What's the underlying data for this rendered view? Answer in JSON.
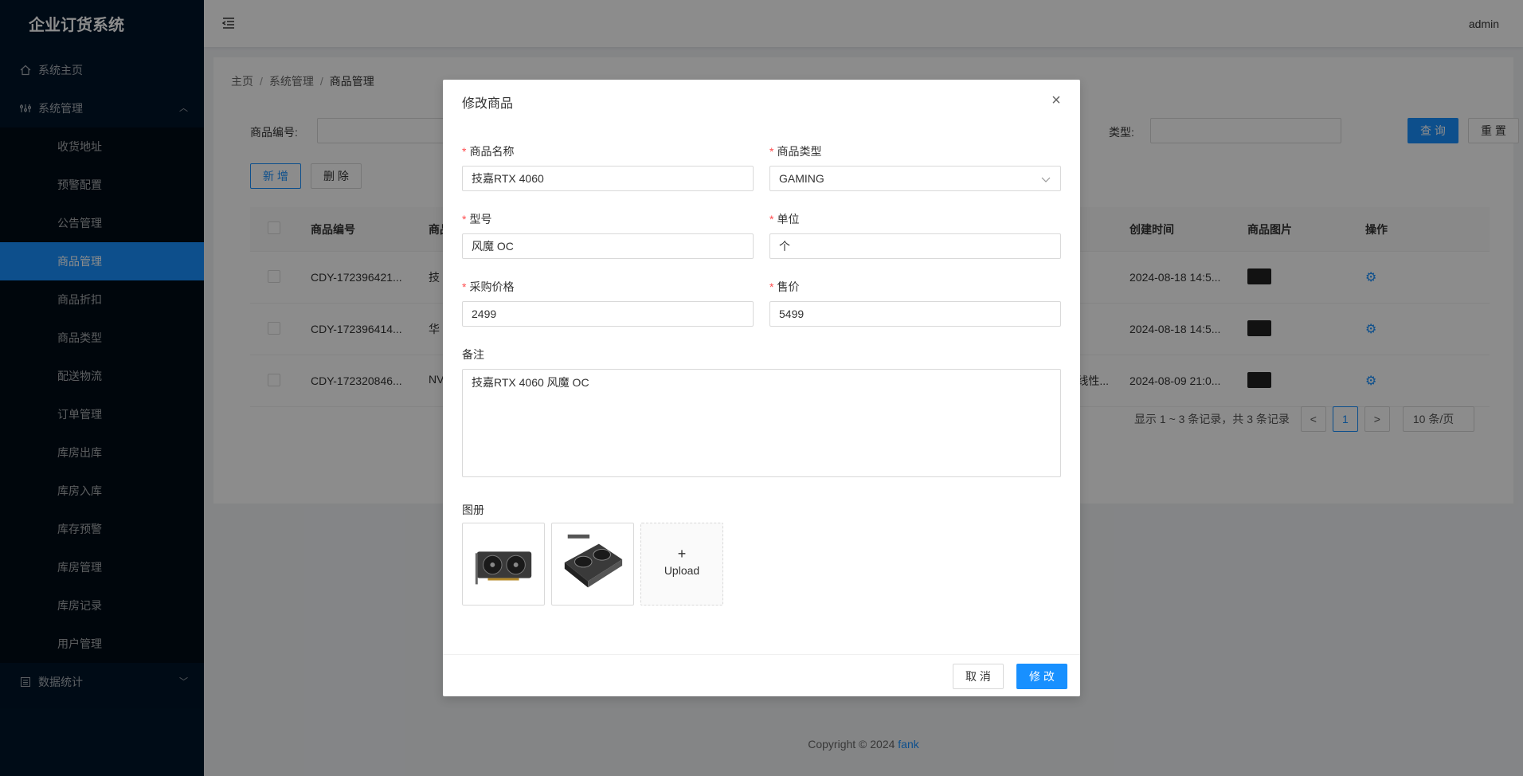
{
  "app": {
    "title": "企业订货系统",
    "user": "admin"
  },
  "sidebar": {
    "home": "系统主页",
    "system": "系统管理",
    "items": [
      "收货地址",
      "预警配置",
      "公告管理",
      "商品管理",
      "商品折扣",
      "商品类型",
      "配送物流",
      "订单管理",
      "库房出库",
      "库房入库",
      "库存预警",
      "库房管理",
      "库房记录",
      "用户管理"
    ],
    "stats": "数据统计"
  },
  "breadcrumb": {
    "home": "主页",
    "sep": "/",
    "section": "系统管理",
    "current": "商品管理"
  },
  "search": {
    "code_label": "商品编号:",
    "type_label": "类型:",
    "query": "查 询",
    "reset": "重 置"
  },
  "toolbar": {
    "add": "新 增",
    "delete": "删 除"
  },
  "table": {
    "headers": {
      "code": "商品编号",
      "name": "商品",
      "created": "创建时间",
      "image": "商品图片",
      "ops": "操作"
    },
    "rows": [
      {
        "code": "CDY-172396421...",
        "name": "技",
        "extra": "",
        "created": "2024-08-18 14:5..."
      },
      {
        "code": "CDY-172396414...",
        "name": "华",
        "extra": "",
        "created": "2024-08-18 14:5..."
      },
      {
        "code": "CDY-172320846...",
        "name": "NV",
        "extra": "线性...",
        "created": "2024-08-09 21:0..."
      }
    ]
  },
  "pager": {
    "info": "显示 1 ~ 3 条记录，共 3 条记录",
    "page": "1",
    "prev": "<",
    "next": ">",
    "size": "10 条/页"
  },
  "footer": {
    "copyright": "Copyright © 2024 ",
    "author": "fank"
  },
  "modal": {
    "title": "修改商品",
    "close": "×",
    "fields": {
      "name_label": "商品名称",
      "name_value": "技嘉RTX 4060",
      "type_label": "商品类型",
      "type_value": "GAMING",
      "model_label": "型号",
      "model_value": "风魔 OC",
      "unit_label": "单位",
      "unit_value": "个",
      "cost_label": "采购价格",
      "cost_value": "2499",
      "price_label": "售价",
      "price_value": "5499",
      "remark_label": "备注",
      "remark_value": "技嘉RTX 4060 风魔 OC",
      "album_label": "图册"
    },
    "upload": {
      "plus": "+",
      "text": "Upload"
    },
    "cancel": "取 消",
    "submit": "修 改"
  }
}
